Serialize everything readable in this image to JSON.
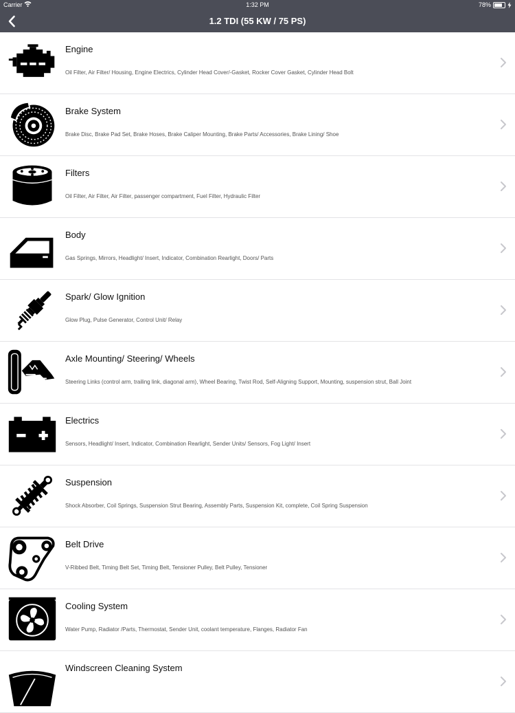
{
  "status_bar": {
    "carrier": "Carrier",
    "time": "1:32 PM",
    "battery": "78%",
    "battery_level": 0.78
  },
  "nav": {
    "title": "1.2 TDI (55 KW / 75 PS)",
    "back_icon": "chevron-left-icon"
  },
  "categories": [
    {
      "title": "Engine",
      "subtitle": "Oil Filter, Air Filter/ Housing, Engine Electrics, Cylinder Head Cover/-Gasket, Rocker Cover Gasket, Cylinder Head Bolt",
      "icon": "engine-icon"
    },
    {
      "title": "Brake System",
      "subtitle": "Brake Disc, Brake Pad Set, Brake Hoses, Brake Caliper Mounting, Brake Parts/ Accessories, Brake Lining/ Shoe",
      "icon": "brake-disc-icon"
    },
    {
      "title": "Filters",
      "subtitle": "Oil Filter, Air Filter, Air Filter, passenger compartment, Fuel Filter, Hydraulic Filter",
      "icon": "oil-filter-icon"
    },
    {
      "title": "Body",
      "subtitle": "Gas Springs, Mirrors, Headlight/ Insert, Indicator, Combination Rearlight, Doors/ Parts",
      "icon": "car-door-icon"
    },
    {
      "title": "Spark/  Glow Ignition",
      "subtitle": "Glow Plug, Pulse Generator, Control Unit/ Relay",
      "icon": "spark-plug-icon"
    },
    {
      "title": "Axle Mounting/  Steering/  Wheels",
      "subtitle": "Steering Links (control arm, trailing link, diagonal arm), Wheel Bearing, Twist Rod, Self-Aligning Support, Mounting, suspension strut, Ball Joint",
      "icon": "axle-wheel-icon"
    },
    {
      "title": "Electrics",
      "subtitle": "Sensors, Headlight/ Insert, Indicator, Combination Rearlight, Sender Units/ Sensors, Fog Light/ Insert",
      "icon": "battery-icon"
    },
    {
      "title": "Suspension",
      "subtitle": "Shock Absorber, Coil Springs, Suspension Strut Bearing, Assembly Parts, Suspension Kit, complete, Coil Spring Suspension",
      "icon": "shock-absorber-icon"
    },
    {
      "title": "Belt Drive",
      "subtitle": "V-Ribbed Belt, Timing Belt Set, Timing Belt, Tensioner Pulley, Belt Pulley, Tensioner",
      "icon": "belt-drive-icon"
    },
    {
      "title": "Cooling System",
      "subtitle": "Water Pump, Radiator /Parts, Thermostat, Sender Unit, coolant temperature, Flanges, Radiator Fan",
      "icon": "radiator-fan-icon"
    },
    {
      "title": "Windscreen Cleaning System",
      "subtitle": "",
      "icon": "windscreen-wiper-icon"
    }
  ]
}
